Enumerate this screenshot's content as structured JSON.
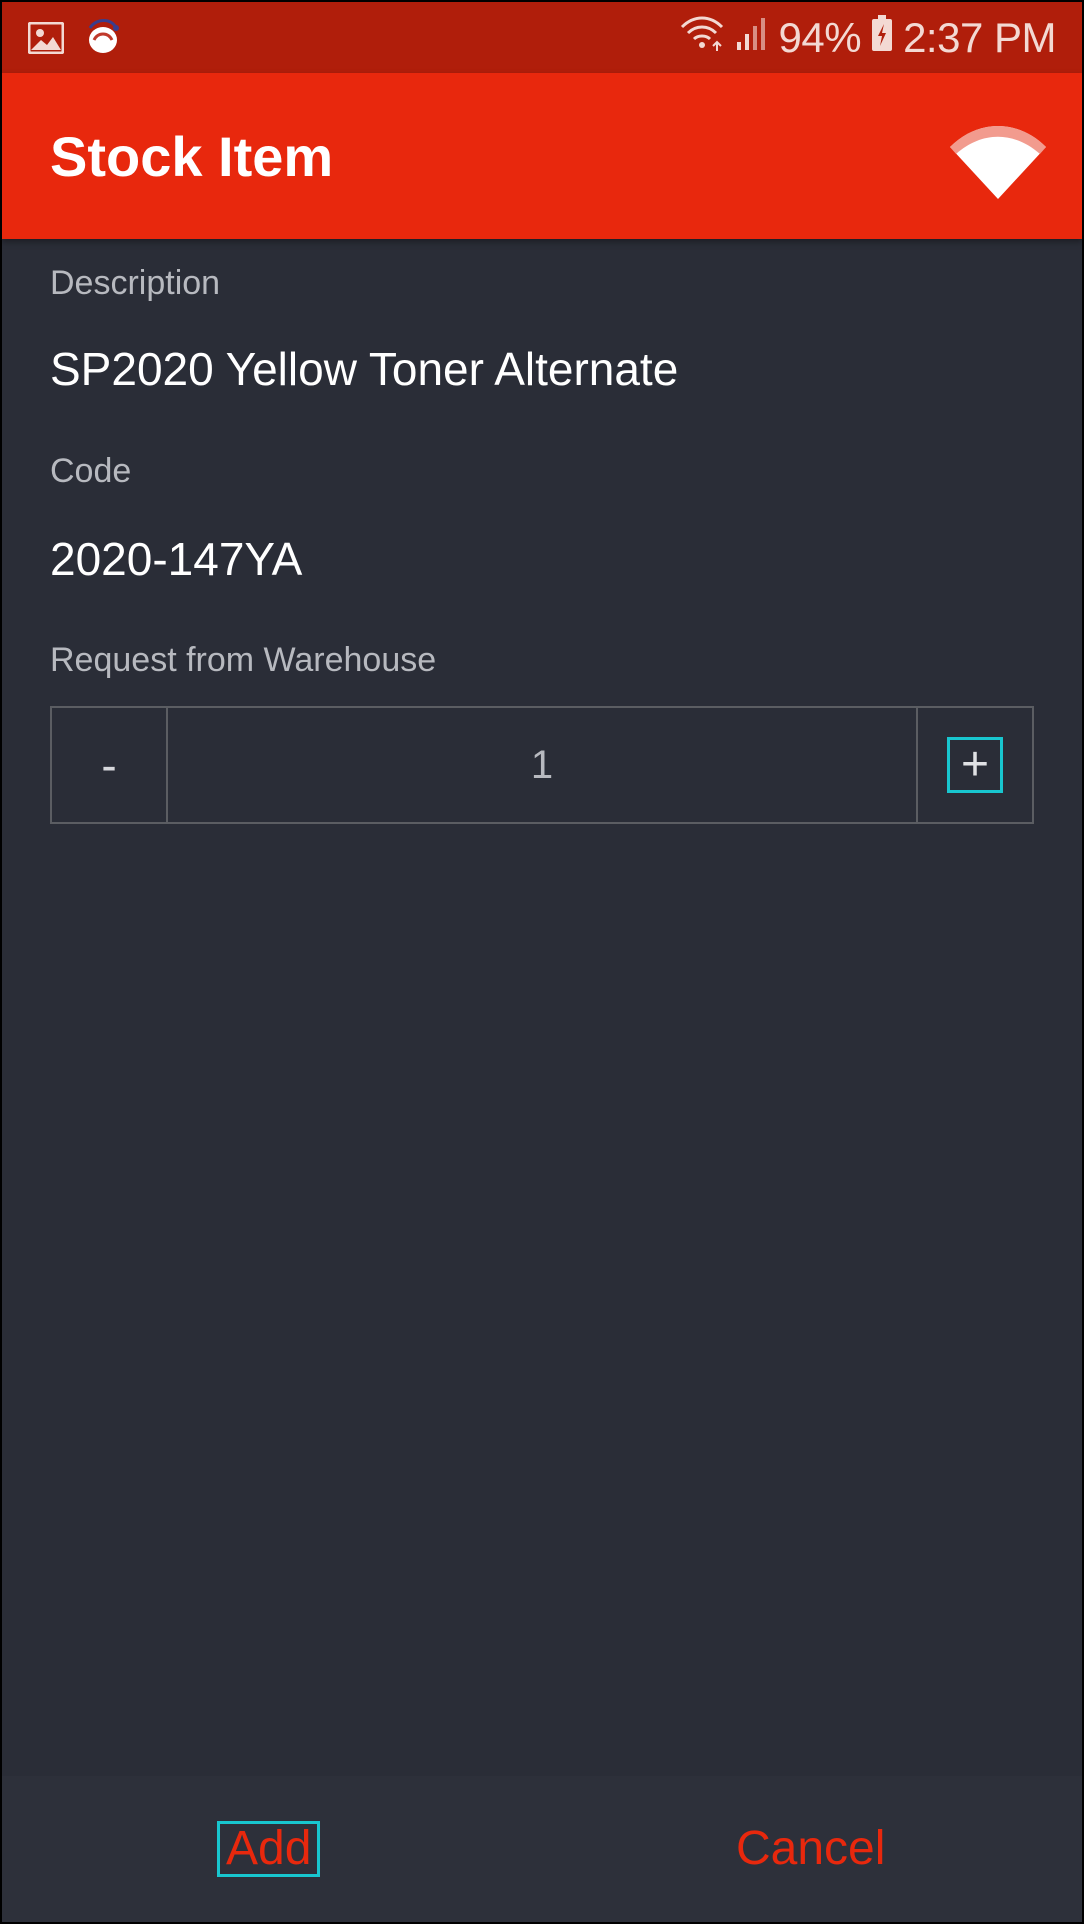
{
  "status_bar": {
    "battery": "94%",
    "time": "2:37 PM",
    "icons": [
      "image-icon",
      "notification-app-icon",
      "wifi-signal-icon",
      "cell-signal-icon",
      "battery-charging-icon"
    ]
  },
  "app_bar": {
    "title": "Stock Item",
    "logo_icon": "wifi-logo-icon"
  },
  "form": {
    "description_label": "Description",
    "description_value": "SP2020 Yellow Toner Alternate",
    "code_label": "Code",
    "code_value": "2020-147YA",
    "request_label": "Request from Warehouse",
    "quantity": {
      "decrement_label": "-",
      "value": "1",
      "increment_label": "+"
    }
  },
  "actions": {
    "add_label": "Add",
    "cancel_label": "Cancel"
  },
  "colors": {
    "status_bar": "#b01e0b",
    "app_bar": "#e8280d",
    "background": "#2a2d37",
    "accent": "#e8280d",
    "focus": "#18c6cf"
  }
}
